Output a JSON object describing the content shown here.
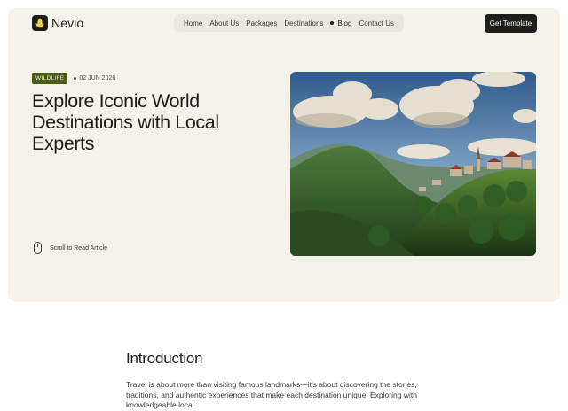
{
  "brand": {
    "name": "Nevio"
  },
  "nav": {
    "items": [
      {
        "label": "Home",
        "active": false
      },
      {
        "label": "About Us",
        "active": false
      },
      {
        "label": "Packages",
        "active": false
      },
      {
        "label": "Destinations",
        "active": false
      },
      {
        "label": "Blog",
        "active": true
      },
      {
        "label": "Contact Us",
        "active": false
      }
    ]
  },
  "cta": {
    "label": "Get Template"
  },
  "article": {
    "tag": "WILDLIFE",
    "date": "02 JUN 2026",
    "title": "Explore Iconic World Destinations with Local Experts",
    "scroll_label": "Scroll to Read Article"
  },
  "intro": {
    "heading": "Introduction",
    "body": "Travel is about more than visiting famous landmarks—it's about discovering the stories, traditions, and authentic experiences that make each destination unique. Exploring with knowledgeable local"
  },
  "colors": {
    "hero_bg": "#f5f2ea",
    "nav_bg": "#ebe8e0",
    "tag_bg": "#4a5a18",
    "dark": "#1d1d1b"
  },
  "icons": {
    "logo": "leaf-logo-icon",
    "scroll": "mouse-icon",
    "active_nav": "dot-icon"
  }
}
